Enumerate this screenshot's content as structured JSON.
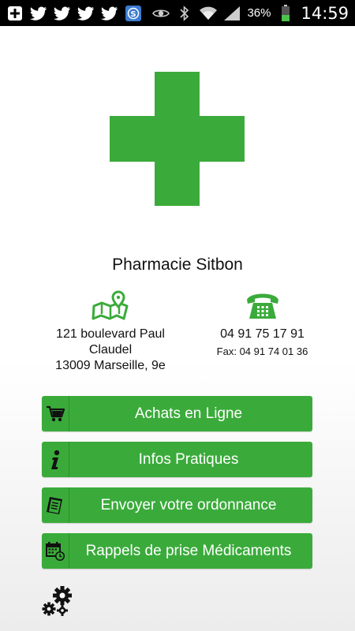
{
  "statusbar": {
    "battery_percent": "36%",
    "time": "14:59",
    "icons": [
      "add-icon",
      "twitter-icon",
      "twitter-icon",
      "twitter-icon",
      "twitter-icon",
      "app-s-icon",
      "eye-icon",
      "bluetooth-icon",
      "wifi-icon",
      "signal-icon",
      "battery-icon"
    ]
  },
  "pharmacy": {
    "name": "Pharmacie Sitbon",
    "address_lines": [
      "121 boulevard Paul",
      "Claudel",
      "13009 Marseille, 9e"
    ],
    "phone": "04 91 75 17 91",
    "fax": "Fax: 04 91 74 01 36"
  },
  "menu": {
    "items": [
      {
        "label": "Achats en Ligne",
        "icon": "cart-icon"
      },
      {
        "label": "Infos Pratiques",
        "icon": "info-icon"
      },
      {
        "label": "Envoyer votre ordonnance",
        "icon": "prescription-icon"
      },
      {
        "label": "Rappels de prise Médicaments",
        "icon": "calendar-clock-icon"
      }
    ]
  },
  "colors": {
    "brand_green": "#3aab3a",
    "cross_green": "#3aab3a",
    "statusbar_bg": "#000000"
  }
}
